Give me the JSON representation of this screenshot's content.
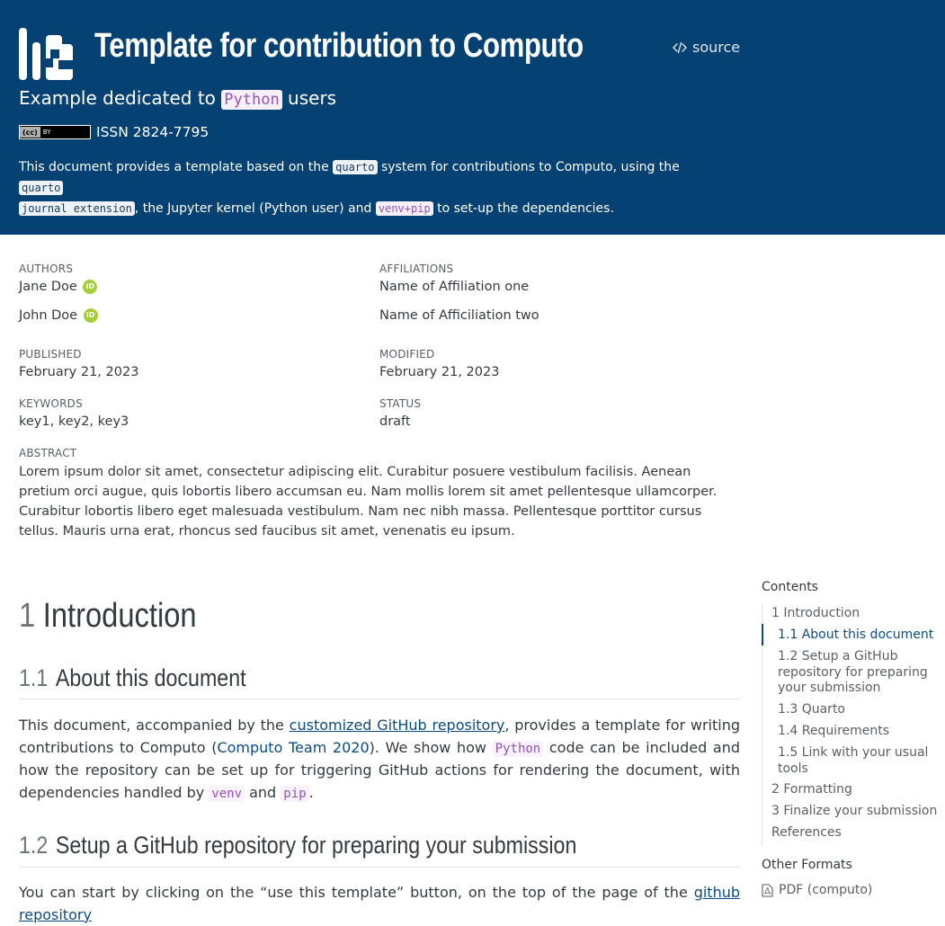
{
  "header": {
    "title": "Template for contribution to Computo",
    "source_label": "source",
    "subtitle_prefix": "Example dedicated to ",
    "subtitle_code": "Python",
    "subtitle_suffix": " users",
    "license_badge_left": "(cc)",
    "license_badge_right": "BY",
    "issn": "ISSN 2824-7795",
    "description": {
      "part1": "This document provides a template based on the ",
      "code1": "quarto",
      "part2": " system for contributions to Computo, using the ",
      "code2a": "quarto",
      "code2b": "journal extension",
      "part3": ", the Jupyter kernel (Python user) and ",
      "code3": "venv+pip",
      "part4": " to set-up the dependencies."
    }
  },
  "meta": {
    "authors_label": "AUTHORS",
    "affiliations_label": "AFFILIATIONS",
    "authors": [
      "Jane Doe",
      "John Doe"
    ],
    "orcid_label": "iD",
    "affiliations": [
      "Name of Affiliation one",
      "Name of Afficiliation two"
    ],
    "published_label": "PUBLISHED",
    "published": "February 21, 2023",
    "modified_label": "MODIFIED",
    "modified": "February 21, 2023",
    "keywords_label": "KEYWORDS",
    "keywords": "key1, key2, key3",
    "status_label": "STATUS",
    "status": "draft",
    "abstract_label": "ABSTRACT",
    "abstract": "Lorem ipsum dolor sit amet, consectetur adipiscing elit. Curabitur posuere vestibulum facilisis. Aenean pretium orci augue, quis lobortis libero accumsan eu. Nam mollis lorem sit amet pellentesque ullamcorper. Curabitur lobortis libero eget malesuada vestibulum. Nam nec nibh massa. Pellentesque porttitor cursus tellus. Mauris urna erat, rhoncus sed faucibus sit amet, venenatis eu ipsum."
  },
  "content": {
    "h1_num": "1",
    "h1_text": "Introduction",
    "h2a_num": "1.1",
    "h2a_text": "About this document",
    "p1": {
      "t1": "This document, accompanied by the ",
      "link": "customized GitHub repository",
      "t2": ", provides a template for writing contributions to Computo (",
      "cite": "Computo Team 2020",
      "t3": "). We show how ",
      "code1": "Python",
      "t4": " code can be included and how the repository can be set up for triggering GitHub actions for rendering the document, with dependencies handled by ",
      "code2": "venv",
      "t5": " and ",
      "code3": "pip",
      "t6": "."
    },
    "h2b_num": "1.2",
    "h2b_text": "Setup a GitHub repository for preparing your submission",
    "p2": {
      "t1": "You can start by clicking on the “use this template” button, on the top of the page of the ",
      "link": "github repository"
    }
  },
  "toc": {
    "title": "Contents",
    "items": [
      "1 Introduction",
      "1.1 About this document",
      "1.2 Setup a GitHub repository for preparing your submission",
      "1.3 Quarto",
      "1.4 Requirements",
      "1.5 Link with your usual tools",
      "2 Formatting",
      "3 Finalize your submission",
      "References"
    ],
    "other_formats_title": "Other Formats",
    "pdf_label": "PDF (computo)"
  },
  "colors": {
    "banner": "#054273",
    "link": "#0b4b82",
    "code_purple": "#9753b8",
    "orcid": "#a6ce39"
  }
}
